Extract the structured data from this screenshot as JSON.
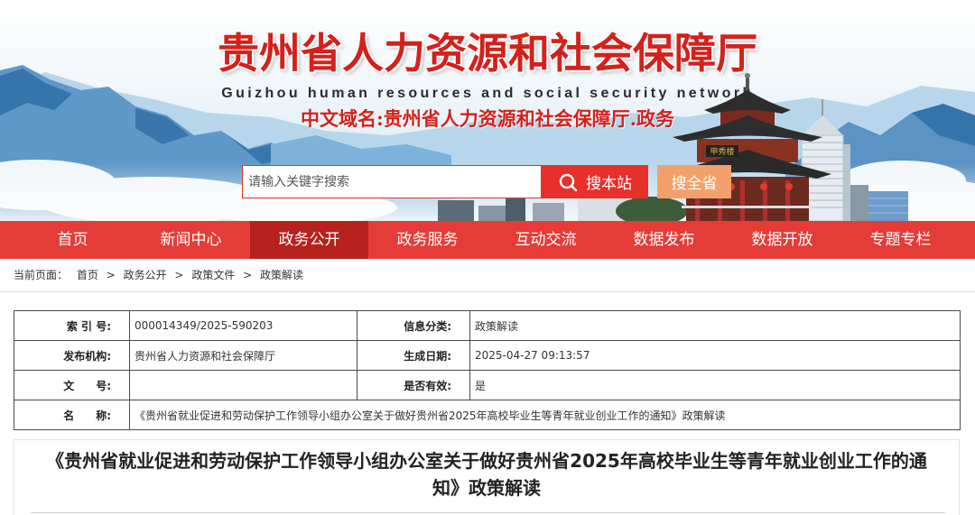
{
  "colors": {
    "brand_red": "#e63c37",
    "nav_active": "#b7211d",
    "search_red": "#e8302b",
    "search_orange": "#f3a06c",
    "title_red": "#d4211b"
  },
  "header": {
    "title": "贵州省人力资源和社会保障厅",
    "subtitle": "Guizhou human resources and social security network",
    "domain": "中文域名:贵州省人力资源和社会保障厅.政务",
    "building_sign": "甲秀楼"
  },
  "search": {
    "placeholder": "请输入关键字搜索",
    "site_button": "搜本站",
    "province_button": "搜全省",
    "site_button_icon": "search-icon"
  },
  "nav": {
    "items": [
      {
        "label": "首页",
        "active": false
      },
      {
        "label": "新闻中心",
        "active": false
      },
      {
        "label": "政务公开",
        "active": true
      },
      {
        "label": "政务服务",
        "active": false
      },
      {
        "label": "互动交流",
        "active": false
      },
      {
        "label": "数据发布",
        "active": false
      },
      {
        "label": "数据开放",
        "active": false
      },
      {
        "label": "专题专栏",
        "active": false
      }
    ]
  },
  "breadcrumb": {
    "prefix": "当前页面：",
    "separator": ">",
    "items": [
      "首页",
      "政务公开",
      "政策文件",
      "政策解读"
    ]
  },
  "meta_table": {
    "index_no": {
      "label": "索 引 号:",
      "value": "000014349/2025-590203"
    },
    "category": {
      "label": "信息分类:",
      "value": "政策解读"
    },
    "publisher": {
      "label": "发布机构:",
      "value": "贵州省人力资源和社会保障厅"
    },
    "created_date": {
      "label": "生成日期:",
      "value": "2025-04-27 09:13:57"
    },
    "doc_no": {
      "label": "文　　号:",
      "value": ""
    },
    "is_valid": {
      "label": "是否有效:",
      "value": "是"
    },
    "name": {
      "label": "名　　称:",
      "value": "《贵州省就业促进和劳动保护工作领导小组办公室关于做好贵州省2025年高校毕业生等青年就业创业工作的通知》政策解读"
    }
  },
  "article": {
    "title": "《贵州省就业促进和劳动保护工作领导小组办公室关于做好贵州省2025年高校毕业生等青年就业创业工作的通知》政策解读"
  }
}
